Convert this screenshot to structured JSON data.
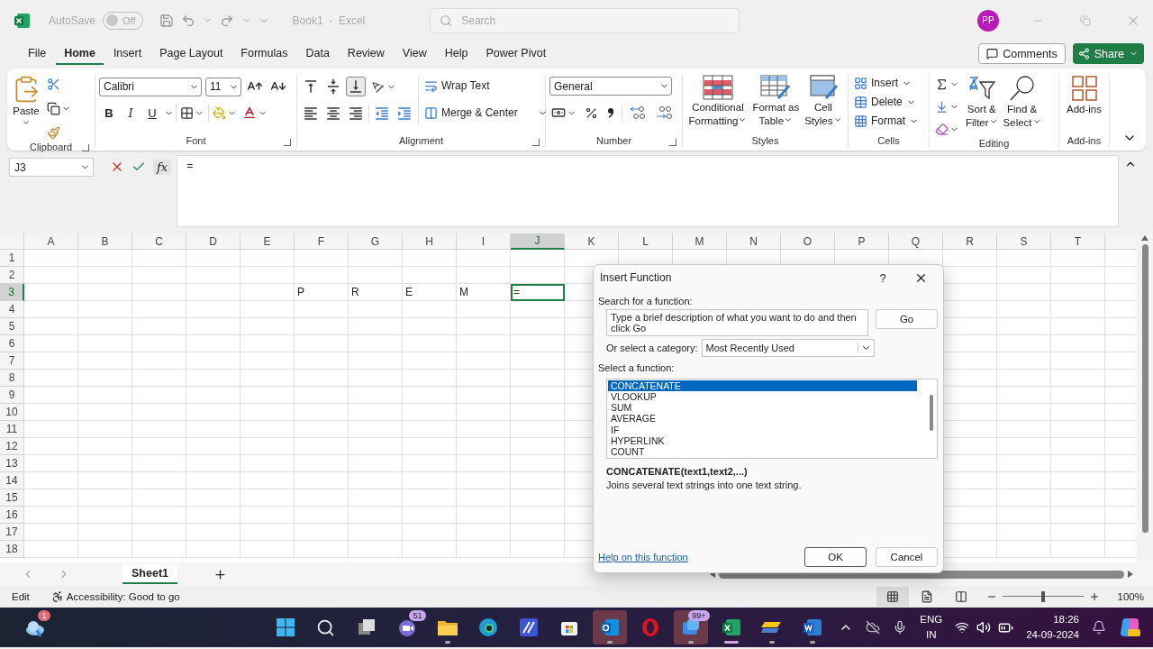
{
  "title_bar": {
    "autosave_label": "AutoSave",
    "autosave": {
      "on": false,
      "label": "Off"
    },
    "title": "Book1  -  Excel",
    "search": {
      "placeholder": "Search"
    },
    "avatar": "PP"
  },
  "menu_tabs": [
    {
      "label": "File",
      "selected": false
    },
    {
      "label": "Home",
      "selected": true
    },
    {
      "label": "Insert",
      "selected": false
    },
    {
      "label": "Page Layout",
      "selected": false
    },
    {
      "label": "Formulas",
      "selected": false
    },
    {
      "label": "Data",
      "selected": false
    },
    {
      "label": "Review",
      "selected": false
    },
    {
      "label": "View",
      "selected": false
    },
    {
      "label": "Help",
      "selected": false
    },
    {
      "label": "Power Pivot",
      "selected": false
    }
  ],
  "comments_button": "Comments",
  "share_button": "Share",
  "ribbon": {
    "groups": [
      {
        "kind": "clipboard",
        "label": "Clipboard",
        "paste": "Paste"
      },
      {
        "kind": "font",
        "label": "Font",
        "font": "Calibri",
        "size": "11",
        "bold": "B",
        "italic": "I",
        "underline": "U"
      },
      {
        "kind": "alignment",
        "label": "Alignment",
        "vertical_align": [
          {
            "selected": false
          },
          {
            "selected": false
          },
          {
            "selected": true
          }
        ],
        "wrap": "Wrap Text",
        "merge": "Merge & Center"
      },
      {
        "kind": "number",
        "label": "Number",
        "format": "General"
      },
      {
        "kind": "large",
        "label": "Styles",
        "items": [
          {
            "lines": [
              "Conditional",
              "Formatting"
            ],
            "dropdown": true
          },
          {
            "lines": [
              "Format as",
              "Table"
            ],
            "dropdown": true
          },
          {
            "lines": [
              "Cell",
              "Styles"
            ],
            "dropdown": true
          }
        ]
      },
      {
        "kind": "cells",
        "label": "Cells",
        "items": [
          {
            "label": "Insert"
          },
          {
            "label": "Delete"
          },
          {
            "label": "Format"
          }
        ]
      },
      {
        "kind": "editing",
        "label": "Editing",
        "items": [
          {
            "lines": [
              "Sort &",
              "Filter"
            ],
            "dropdown": true
          },
          {
            "lines": [
              "Find &",
              "Select"
            ],
            "dropdown": true
          }
        ]
      },
      {
        "kind": "addins",
        "label": "Add-ins",
        "items": [
          {
            "lines": [
              "Add-ins"
            ],
            "dropdown": false
          }
        ]
      }
    ]
  },
  "formula_bar": {
    "name_box": "J3",
    "fx": "fx",
    "formula": "="
  },
  "sheet": {
    "columns": [
      {
        "label": "A",
        "selected": false
      },
      {
        "label": "B",
        "selected": false
      },
      {
        "label": "C",
        "selected": false
      },
      {
        "label": "D",
        "selected": false
      },
      {
        "label": "E",
        "selected": false
      },
      {
        "label": "F",
        "selected": false
      },
      {
        "label": "G",
        "selected": false
      },
      {
        "label": "H",
        "selected": false
      },
      {
        "label": "I",
        "selected": false
      },
      {
        "label": "J",
        "selected": true
      },
      {
        "label": "K",
        "selected": false
      },
      {
        "label": "L",
        "selected": false
      },
      {
        "label": "M",
        "selected": false
      },
      {
        "label": "N",
        "selected": false
      },
      {
        "label": "O",
        "selected": false
      },
      {
        "label": "P",
        "selected": false
      },
      {
        "label": "Q",
        "selected": false
      },
      {
        "label": "R",
        "selected": false
      },
      {
        "label": "S",
        "selected": false
      },
      {
        "label": "T",
        "selected": false
      }
    ],
    "rows": [
      {
        "label": "1",
        "selected": false
      },
      {
        "label": "2",
        "selected": false
      },
      {
        "label": "3",
        "selected": true,
        "cells": [
          null,
          null,
          null,
          null,
          null,
          {
            "text": "P",
            "selected": false
          },
          {
            "text": "R",
            "selected": false
          },
          {
            "text": "E",
            "selected": false
          },
          {
            "text": "M",
            "selected": false
          },
          {
            "text": "=",
            "selected": true
          }
        ]
      },
      {
        "label": "4",
        "selected": false
      },
      {
        "label": "5",
        "selected": false
      },
      {
        "label": "6",
        "selected": false
      },
      {
        "label": "7",
        "selected": false
      },
      {
        "label": "8",
        "selected": false
      },
      {
        "label": "9",
        "selected": false
      },
      {
        "label": "10",
        "selected": false
      },
      {
        "label": "11",
        "selected": false
      },
      {
        "label": "12",
        "selected": false
      },
      {
        "label": "13",
        "selected": false
      },
      {
        "label": "14",
        "selected": false
      },
      {
        "label": "15",
        "selected": false
      },
      {
        "label": "16",
        "selected": false
      },
      {
        "label": "17",
        "selected": false
      },
      {
        "label": "18",
        "selected": false
      }
    ]
  },
  "sheet_tabs": [
    {
      "label": "Sheet1",
      "selected": true
    }
  ],
  "status_bar": {
    "mode": "Edit",
    "accessibility": "Accessibility: Good to go",
    "views": [
      {
        "selected": true
      },
      {
        "selected": false
      },
      {
        "selected": false
      }
    ],
    "zoom": {
      "level": 0.5,
      "label": "100%"
    }
  },
  "dialog": {
    "title": "Insert Function",
    "help": "?",
    "search_label": "Search for a function:",
    "search_value": "Type a brief description of what you want to do and then click Go",
    "go": "Go",
    "category_label": "Or select a category:",
    "category": "Most Recently Used",
    "list_label": "Select a function:",
    "functions": [
      {
        "label": "CONCATENATE",
        "selected": true
      },
      {
        "label": "VLOOKUP",
        "selected": false
      },
      {
        "label": "SUM",
        "selected": false
      },
      {
        "label": "AVERAGE",
        "selected": false
      },
      {
        "label": "IF",
        "selected": false
      },
      {
        "label": "HYPERLINK",
        "selected": false
      },
      {
        "label": "COUNT",
        "selected": false
      }
    ],
    "signature": "CONCATENATE(text1,text2,...)",
    "description": "Joins several text strings into one text string.",
    "help_link": "Help on this function",
    "ok": "OK",
    "cancel": "Cancel"
  },
  "taskbar": {
    "weather_badge": "1",
    "apps": [
      {
        "running": false,
        "active": false,
        "attention": false
      },
      {
        "running": false,
        "active": false,
        "attention": false
      },
      {
        "running": false,
        "active": false,
        "attention": false
      },
      {
        "running": false,
        "active": false,
        "attention": false,
        "badge": "51"
      },
      {
        "running": true,
        "active": false,
        "attention": false
      },
      {
        "running": false,
        "active": false,
        "attention": false
      },
      {
        "running": false,
        "active": false,
        "attention": false
      },
      {
        "running": false,
        "active": false,
        "attention": false
      },
      {
        "running": true,
        "active": false,
        "attention": true
      },
      {
        "running": false,
        "active": false,
        "attention": false
      },
      {
        "running": true,
        "active": false,
        "attention": true,
        "badge": "99+"
      },
      {
        "running": true,
        "active": true,
        "attention": false
      },
      {
        "running": true,
        "active": false,
        "attention": false
      },
      {
        "running": true,
        "active": false,
        "attention": false
      }
    ],
    "language": [
      "ENG",
      "IN"
    ],
    "time": "18:26",
    "date": "24-09-2024"
  }
}
